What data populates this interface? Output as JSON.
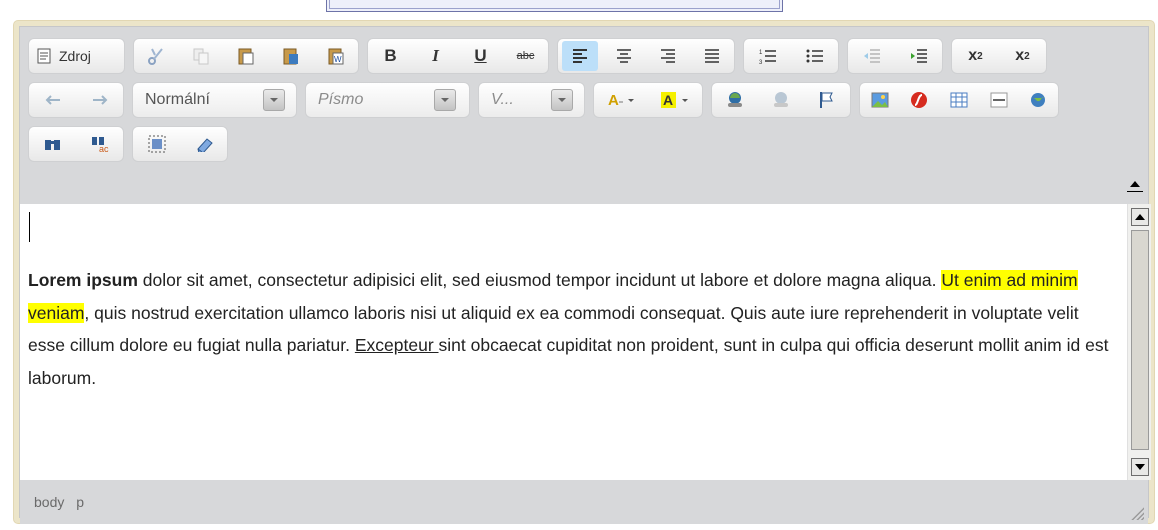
{
  "toolbar": {
    "source_label": "Zdroj",
    "format_value": "Normální",
    "font_placeholder": "Písmo",
    "size_placeholder": "V..."
  },
  "content": {
    "bold_lead": "Lorem ipsum",
    "text_1": " dolor sit amet, consectetur adipisici elit, sed eiusmod tempor incidunt ut labore et dolore magna aliqua. ",
    "highlight": "Ut enim ad minim veniam",
    "text_2": ", quis nostrud exercitation ullamco laboris nisi ut aliquid ex ea commodi consequat. Quis aute iure reprehenderit in voluptate velit esse cillum dolore eu fugiat nulla pariatur. ",
    "underlined": "Excepteur ",
    "text_3": "sint obcaecat cupiditat non proident, sunt in culpa qui officia deserunt mollit anim id est laborum."
  },
  "statusbar": {
    "path": [
      "body",
      "p"
    ]
  },
  "colors": {
    "highlight": "#ffff00",
    "active_button": "#bcdff9",
    "frame": "#ece5c9"
  }
}
